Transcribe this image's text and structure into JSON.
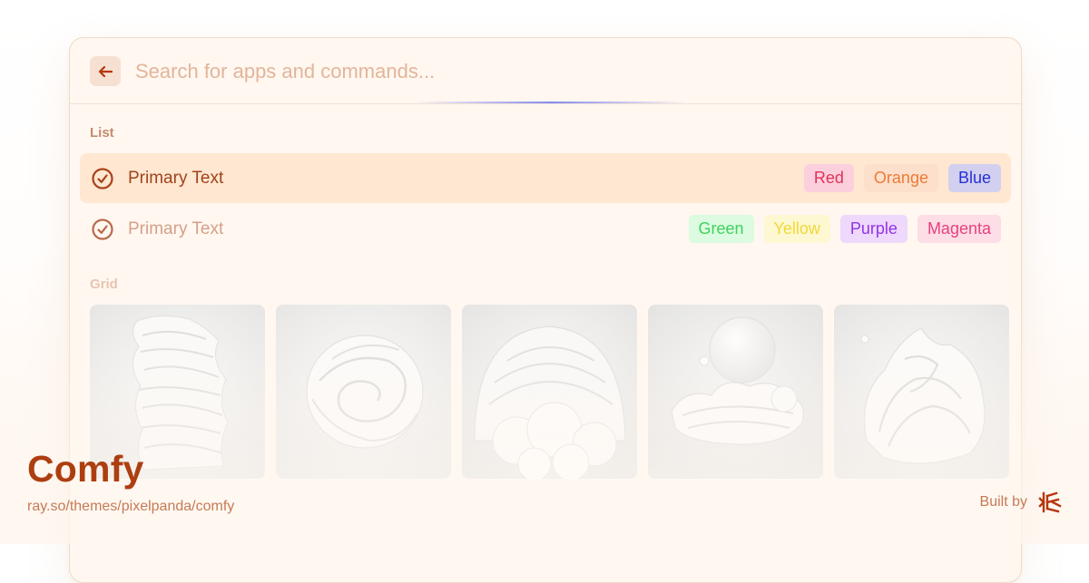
{
  "search": {
    "placeholder": "Search for apps and commands...",
    "value": ""
  },
  "sections": {
    "list_label": "List",
    "grid_label": "Grid"
  },
  "list": [
    {
      "title": "Primary Text",
      "icon": "check-circle-icon",
      "selected": true,
      "tags": [
        "Red",
        "Orange",
        "Blue"
      ]
    },
    {
      "title": "Primary Text",
      "icon": "check-circle-icon",
      "selected": false,
      "tags": [
        "Green",
        "Yellow",
        "Purple",
        "Magenta"
      ]
    }
  ],
  "grid": [
    {
      "icon": "wavy-panel-image"
    },
    {
      "icon": "swirl-image"
    },
    {
      "icon": "dome-clouds-image"
    },
    {
      "icon": "moon-clouds-image"
    },
    {
      "icon": "flame-image"
    }
  ],
  "footer": {
    "title": "Comfy",
    "url": "ray.so/themes/pixelpanda/comfy",
    "built_by": "Built by",
    "logo": "pixelpanda-logo-icon"
  },
  "colors": {
    "accent": "#ad3e10",
    "window_bg": "#fff7f0",
    "selected_row": "#ffe7d1",
    "tag_red": "#e0325e",
    "tag_orange": "#ee7a38",
    "tag_blue": "#2630d8",
    "tag_green": "#41d25e",
    "tag_yellow": "#f2d837",
    "tag_purple": "#9133e8",
    "tag_magenta": "#e8417f"
  }
}
